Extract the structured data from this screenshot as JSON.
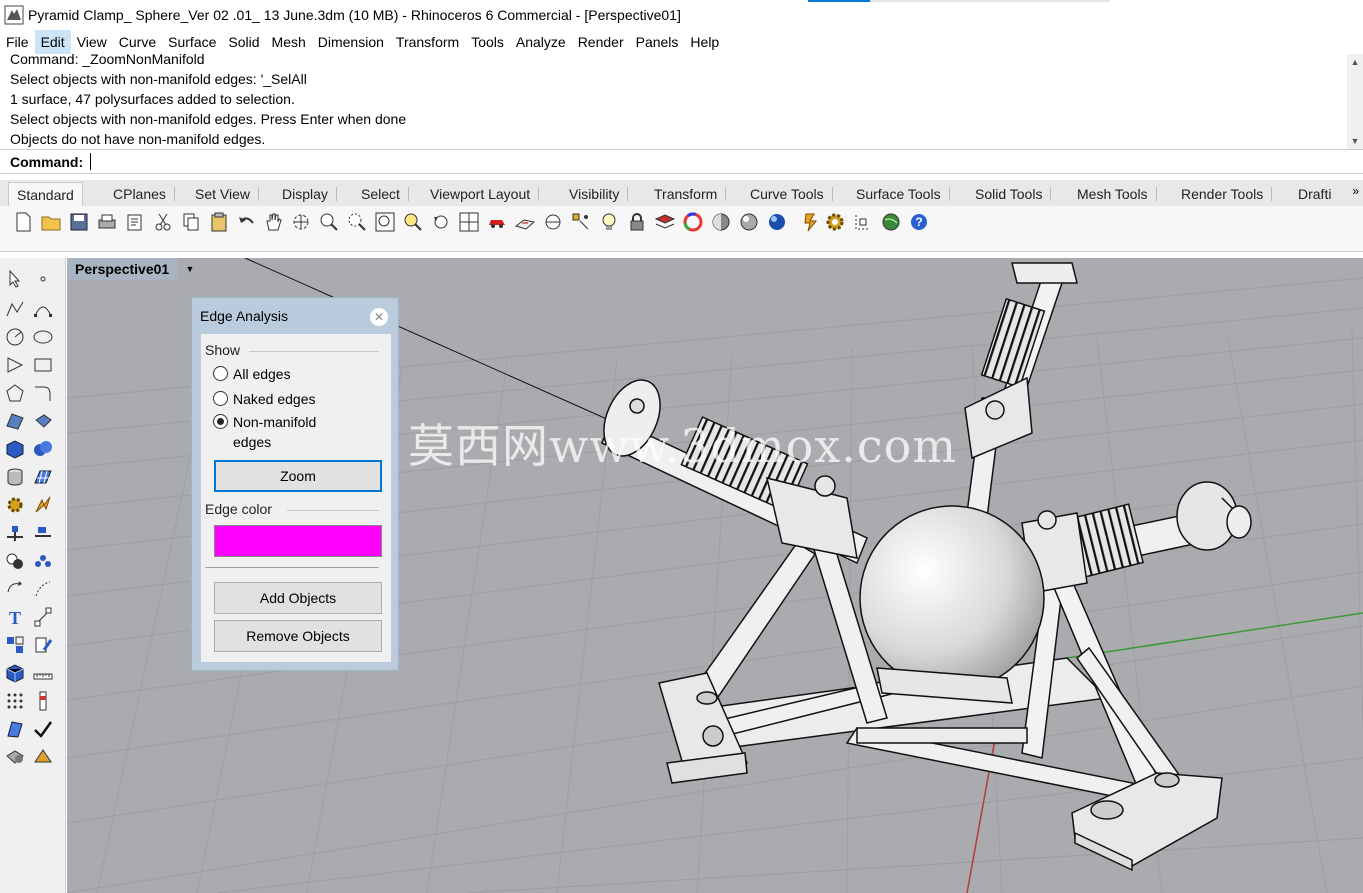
{
  "window": {
    "title": "Pyramid Clamp_ Sphere_Ver 02 .01_ 13 June.3dm (10 MB) - Rhinoceros 6 Commercial - [Perspective01]"
  },
  "menu": [
    "File",
    "Edit",
    "View",
    "Curve",
    "Surface",
    "Solid",
    "Mesh",
    "Dimension",
    "Transform",
    "Tools",
    "Analyze",
    "Render",
    "Panels",
    "Help"
  ],
  "command_history": [
    "Command: _ZoomNonManifold",
    "Select objects with non-manifold edges: '_SelAll",
    "1 surface, 47 polysurfaces added to selection.",
    "Select objects with non-manifold edges. Press Enter when done",
    "Objects do not have non-manifold edges."
  ],
  "command_prompt": {
    "label": "Command:"
  },
  "toolbar_tabs": [
    "Standard",
    "CPlanes",
    "Set View",
    "Display",
    "Select",
    "Viewport Layout",
    "Visibility",
    "Transform",
    "Curve Tools",
    "Surface Tools",
    "Solid Tools",
    "Mesh Tools",
    "Render Tools",
    "Drafti"
  ],
  "toolbar_tabs_more": "»",
  "viewport": {
    "name": "Perspective01",
    "menu_arrow": "▼"
  },
  "edge_analysis": {
    "title": "Edge Analysis",
    "close": "✕",
    "show_label": "Show",
    "options": {
      "all": "All edges",
      "naked": "Naked edges",
      "non_manifold": "Non-manifold edges"
    },
    "selected": "non_manifold",
    "zoom_button": "Zoom",
    "edge_color_label": "Edge color",
    "edge_color": "#ff00ff",
    "add_button": "Add Objects",
    "remove_button": "Remove Objects"
  },
  "watermark": "莫西网www.3dmox.com",
  "colors": {
    "viewport_bg": "#a9abae",
    "grid": "#9c9ea1",
    "grid_axis_x": "#b83a3a",
    "grid_axis_y": "#3a9a3a",
    "model": "#f2f2f2",
    "dialog_frame": "#b9cbdc"
  }
}
